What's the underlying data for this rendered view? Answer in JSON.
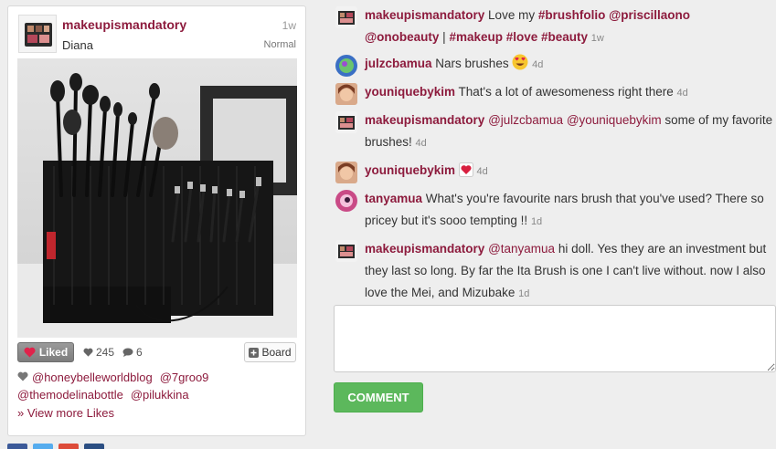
{
  "post": {
    "username": "makeupismandatory",
    "time": "1w",
    "caption": "Diana",
    "filter": "Normal",
    "liked_label": "Liked",
    "like_count": "245",
    "comment_count": "6",
    "board_label": "Board",
    "likers": [
      "@honeybelleworldblog",
      "@7groo9",
      "@themodelinabottle",
      "@pilukkina"
    ],
    "view_more": "» View more Likes"
  },
  "comments": [
    {
      "user": "makeupismandatory",
      "t1": " Love my ",
      "h1": "#brushfolio",
      "m1": " @priscillaono",
      "h2": "@onobeauty",
      "t2": " | ",
      "h3": "#makeup",
      "h4": " #love",
      "h5": " #beauty",
      "ago": "1w"
    },
    {
      "user": "julzcbamua",
      "text": "Nars brushes",
      "ago": "4d"
    },
    {
      "user": "youniquebykim",
      "text": "That's a lot of awesomeness right there",
      "ago": "4d"
    },
    {
      "user": "makeupismandatory",
      "m1": "@julzcbamua",
      "m2": "@youniquebykim",
      "text": " some of my favorite brushes!",
      "ago": "4d"
    },
    {
      "user": "youniquebykim",
      "ago": "4d"
    },
    {
      "user": "tanyamua",
      "text": "What's you're favourite nars brush that you've used? There so pricey but it's sooo tempting !!",
      "ago": "1d"
    },
    {
      "user": "makeupismandatory",
      "m1": "@tanyamua",
      "text": " hi doll. Yes they are an investment but they last so long. By far the Ita Brush is one I can't live without. now I also love the Mei, and Mizubake",
      "ago": "1d"
    }
  ],
  "comment_button": "COMMENT",
  "colors": {
    "accent": "#8d1b3d",
    "button": "#5cb85c"
  },
  "icons": [
    "heart-icon",
    "comments-icon",
    "plus-icon",
    "smiling-heart-eyes-emoji",
    "heart-emoji"
  ]
}
